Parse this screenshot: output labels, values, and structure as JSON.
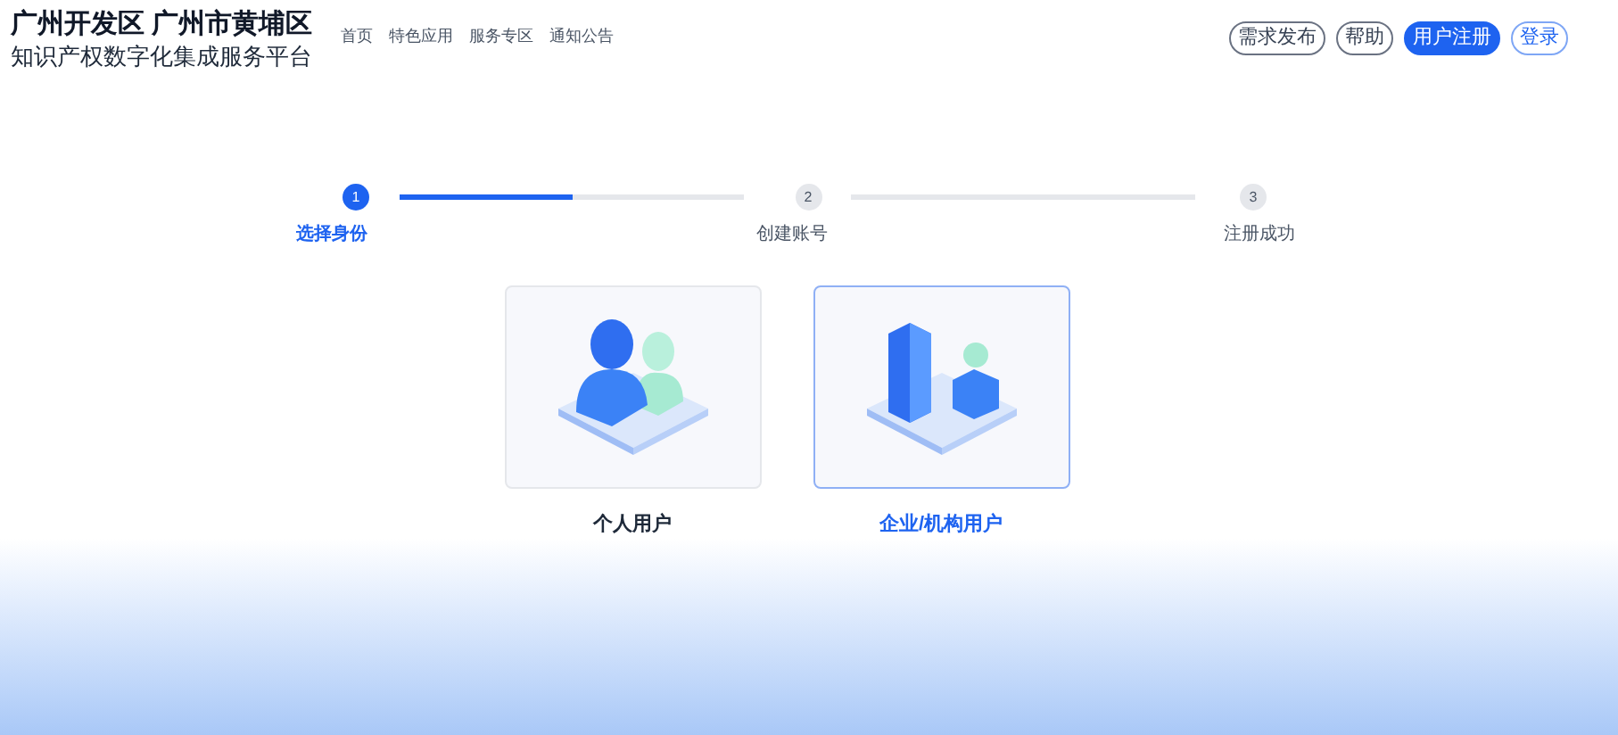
{
  "header": {
    "title": "广州开发区 广州市黄埔区",
    "subtitle": "知识产权数字化集成服务平台",
    "nav": [
      {
        "label": "首页"
      },
      {
        "label": "特色应用"
      },
      {
        "label": "服务专区"
      },
      {
        "label": "通知公告"
      }
    ],
    "actions": [
      {
        "label": "需求发布",
        "kind": "outline"
      },
      {
        "label": "帮助",
        "kind": "outline"
      },
      {
        "label": "用户注册",
        "kind": "primary"
      },
      {
        "label": "登录",
        "kind": "outline-blue"
      }
    ]
  },
  "steps": [
    {
      "number": "1",
      "label": "选择身份",
      "active": true,
      "level": 0.5
    },
    {
      "number": "2",
      "label": "创建账号",
      "active": false
    },
    {
      "number": "3",
      "label": "注册成功",
      "active": false
    }
  ],
  "options": [
    {
      "label": "个人用户",
      "kind": "person",
      "selected": false
    },
    {
      "label": "企业/机构用户",
      "kind": "enterprise",
      "selected": true
    }
  ]
}
